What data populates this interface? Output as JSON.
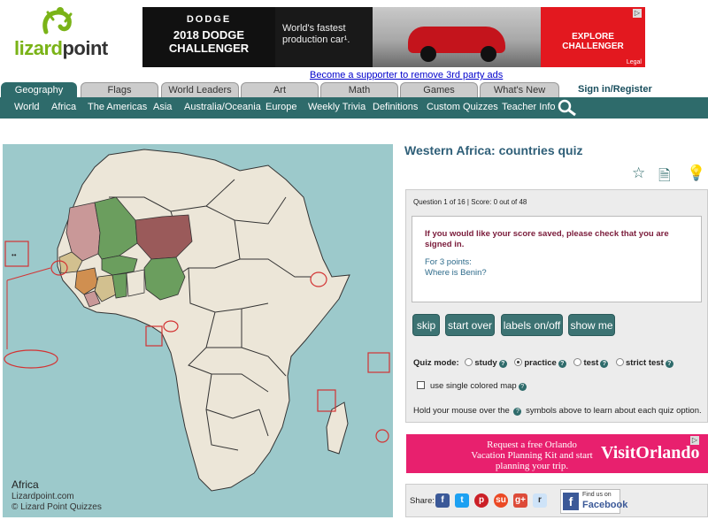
{
  "logo": {
    "text_a": "lizard",
    "text_b": "point"
  },
  "top_ad": {
    "brand": "DODGE",
    "model": "2018 DODGE CHALLENGER",
    "tagline": "World's fastest production car¹.",
    "cta": "EXPLORE CHALLENGER",
    "legal": "Legal",
    "adchoices": "▷"
  },
  "supporter_link": "Become a supporter to remove 3rd party ads",
  "tabs": [
    "Geography",
    "Flags",
    "World Leaders",
    "Art",
    "Math",
    "Games",
    "What's New"
  ],
  "signin": "Sign in/Register",
  "subnav": [
    "World",
    "Africa",
    "The Americas",
    "Asia",
    "Australia/Oceania",
    "Europe",
    "Weekly Trivia",
    "Definitions",
    "Custom Quizzes",
    "Teacher Info"
  ],
  "map": {
    "caption": "Africa",
    "site": "Lizardpoint.com",
    "copyright": "© Lizard Point Quizzes",
    "colors": {
      "ocean": "#9cc9cb",
      "land": "#ece6d8",
      "green": "#6b9e5e",
      "maroon": "#9a5a5a",
      "pink": "#c99898",
      "tan": "#d2c08f",
      "orange": "#d08f50",
      "highlight": "#d33333"
    }
  },
  "quiz": {
    "title": "Western Africa: countries quiz",
    "status": "Question 1 of 16 | Score: 0 out of 48",
    "save_msg": "If you would like your score saved, please check that you are signed in.",
    "points": "For 3 points:",
    "question": "Where is Benin?",
    "buttons": {
      "skip": "skip",
      "start_over": "start over",
      "labels": "labels on/off",
      "show_me": "show me"
    },
    "mode_label": "Quiz mode:",
    "modes": [
      {
        "label": "study",
        "selected": false
      },
      {
        "label": "practice",
        "selected": true
      },
      {
        "label": "test",
        "selected": false
      },
      {
        "label": "strict test",
        "selected": false
      }
    ],
    "single_color": "use single colored map",
    "hover_a": "Hold your mouse over the",
    "hover_b": "symbols above to learn about each quiz option.",
    "help_glyph": "?"
  },
  "orlando_ad": {
    "text": "Request a free Orlando Vacation Planning Kit and start planning your trip.",
    "brand": "VisitOrlando",
    "adchoices": "▷"
  },
  "share": {
    "label": "Share:",
    "icons": [
      "facebook-icon",
      "twitter-icon",
      "pinterest-icon",
      "stumbleupon-icon",
      "google-plus-icon",
      "reddit-icon"
    ],
    "fb_small": "Find us on",
    "fb_big": "Facebook"
  }
}
